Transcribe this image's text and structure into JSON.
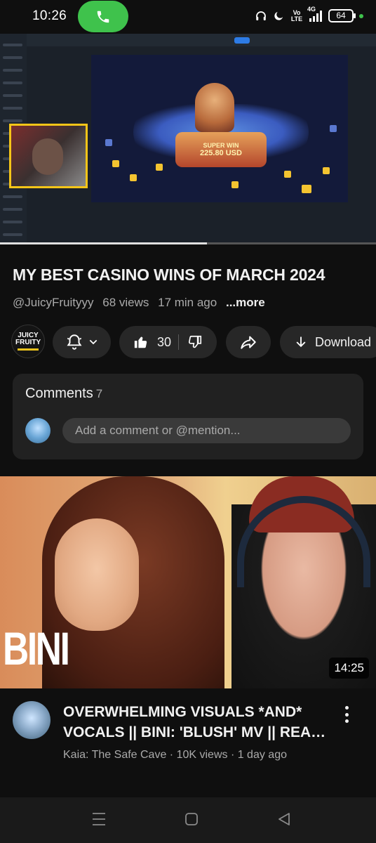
{
  "status_bar": {
    "time": "10:26",
    "network_label": "Vo LTE",
    "signal_label": "4G",
    "battery": "64"
  },
  "player": {
    "game_banner_line1": "SUPER WIN",
    "game_banner_line2": "225.80 USD",
    "progress": 0.55
  },
  "video": {
    "title": "MY BEST CASINO WINS OF MARCH 2024",
    "channel_handle": "@JuicyFruityyy",
    "views": "68 views",
    "age": "17 min ago",
    "more_label": "...more",
    "channel_avatar_text": "JUICY FRUITY"
  },
  "actions": {
    "like_count": "30",
    "download_label": "Download"
  },
  "comments": {
    "heading": "Comments",
    "count": "7",
    "input_placeholder": "Add a comment or @mention..."
  },
  "next_video": {
    "thumbnail_text": "BINI",
    "duration": "14:25",
    "title_line1": "OVERWHELMING VISUALS *AND*",
    "title_line2": "VOCALS || BINI: 'BLUSH' MV || REACTION",
    "meta": "Kaia: The Safe Cave · 10K views · 1 day ago"
  },
  "icons": {
    "call": "phone-icon",
    "headphones": "headphones-icon",
    "dnd": "moon-icon",
    "bell": "bell-icon",
    "like": "thumbs-up-icon",
    "dislike": "thumbs-down-icon",
    "share": "share-icon",
    "download": "download-icon",
    "more": "kebab-icon"
  },
  "colors": {
    "background": "#0f0f0f",
    "pill": "#272727",
    "call_green": "#3fc24c",
    "webcam_border": "#f5c518"
  }
}
